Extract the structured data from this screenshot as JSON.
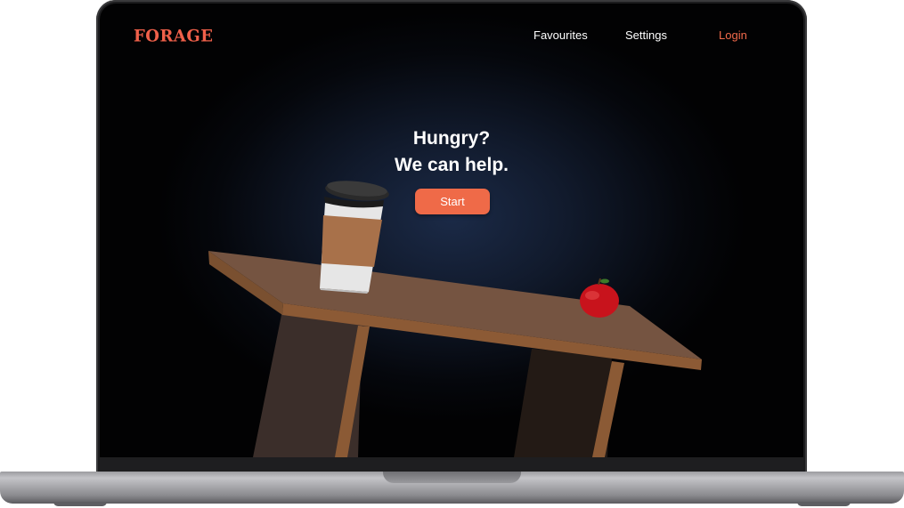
{
  "nav": {
    "logo": "FORAGE",
    "links": [
      {
        "label": "Favourites"
      },
      {
        "label": "Settings"
      },
      {
        "label": "Login"
      }
    ]
  },
  "hero": {
    "line1": "Hungry?",
    "line2": "We can help.",
    "cta_label": "Start"
  },
  "colors": {
    "accent": "#ef6a48",
    "background": "#05070c",
    "text": "#ffffff"
  },
  "illustration": {
    "objects": [
      "coffee-cup",
      "apple",
      "wooden-table"
    ]
  }
}
